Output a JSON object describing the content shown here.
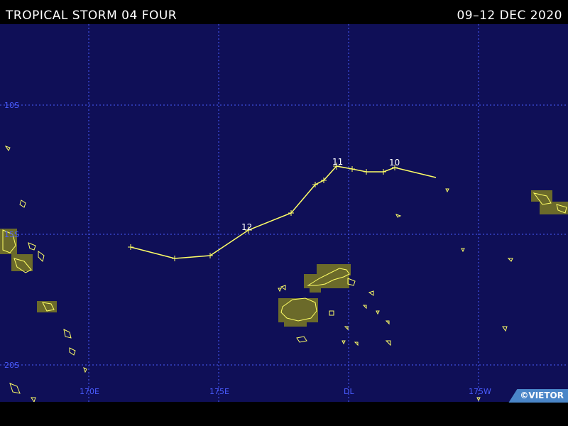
{
  "header": {
    "title": "TROPICAL STORM 04 FOUR",
    "date_range": "09–12 DEC 2020"
  },
  "grid_labels": {
    "lat_10s": "10S",
    "lat_15s": "15S",
    "lat_20s": "20S",
    "lon_170e": "170E",
    "lon_175e": "175E",
    "lon_dl": "DL",
    "lon_175w": "175W"
  },
  "track": {
    "color": "#ffff66",
    "day_labels": [
      "10",
      "11",
      "12"
    ]
  },
  "credit": "©VIETOR",
  "colors": {
    "ocean": "#0f0f57",
    "grid": "#4a5cff",
    "land_fill": "#6b6a2a",
    "coast": "#ffff66"
  }
}
